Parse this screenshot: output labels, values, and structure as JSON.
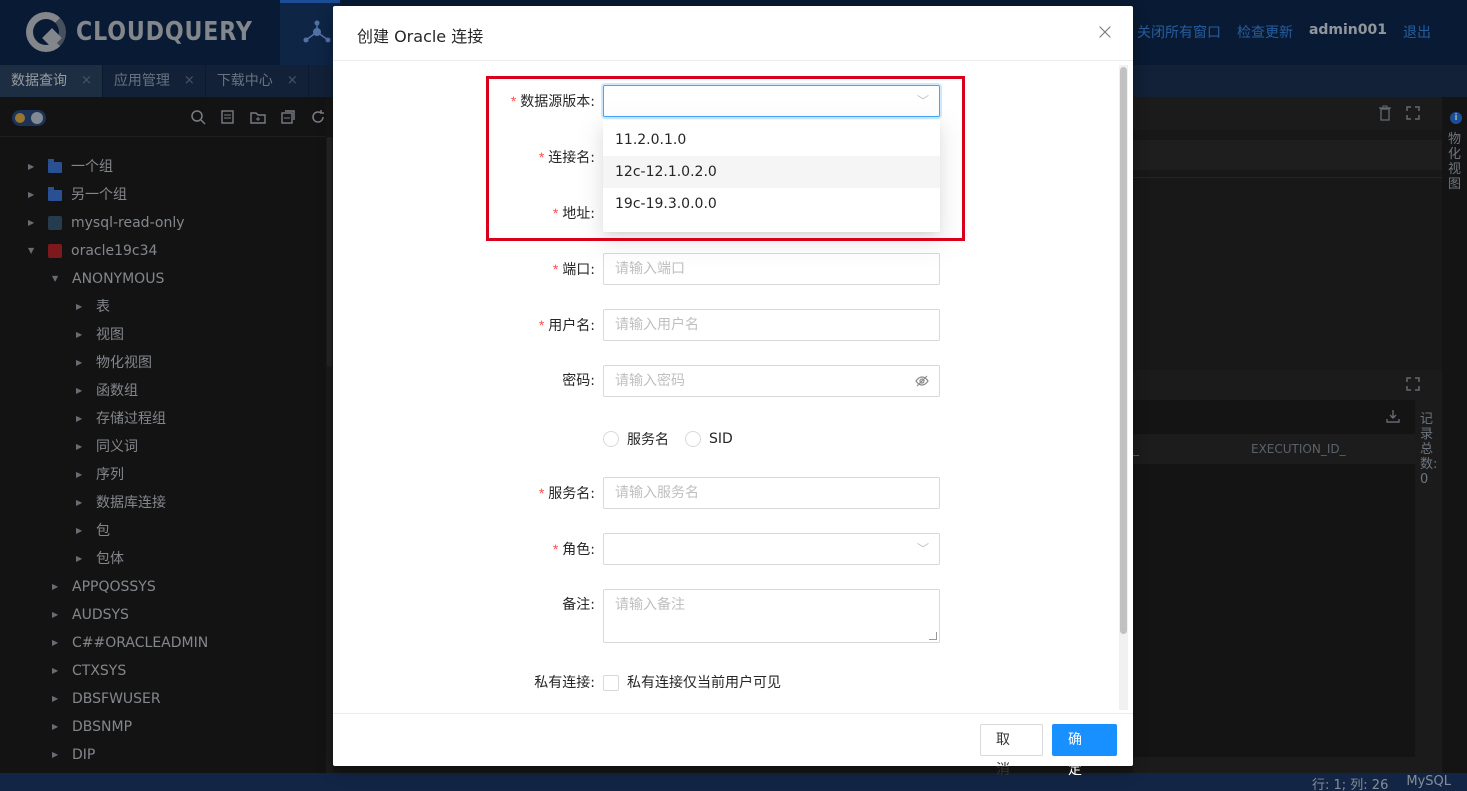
{
  "app": {
    "logo_text": "CLOUDQUERY",
    "top_links": [
      "关闭所有窗口",
      "检查更新"
    ],
    "user": "admin001",
    "logout": "退出"
  },
  "tabs": [
    {
      "label": "数据查询",
      "close": "×"
    },
    {
      "label": "应用管理",
      "close": "×"
    },
    {
      "label": "下载中心",
      "close": "×"
    }
  ],
  "tree": [
    {
      "label": "一个组",
      "level": 0,
      "icon": "folder-icon"
    },
    {
      "label": "另一个组",
      "level": 0,
      "icon": "folder-icon"
    },
    {
      "label": "mysql-read-only",
      "level": 0,
      "icon": "mysql-icon"
    },
    {
      "label": "oracle19c34",
      "level": 0,
      "icon": "oracle-icon",
      "expanded": true
    },
    {
      "label": "ANONYMOUS",
      "level": 1,
      "expanded": true
    },
    {
      "label": "表",
      "level": 2
    },
    {
      "label": "视图",
      "level": 2
    },
    {
      "label": "物化视图",
      "level": 2
    },
    {
      "label": "函数组",
      "level": 2
    },
    {
      "label": "存储过程组",
      "level": 2
    },
    {
      "label": "同义词",
      "level": 2
    },
    {
      "label": "序列",
      "level": 2
    },
    {
      "label": "数据库连接",
      "level": 2
    },
    {
      "label": "包",
      "level": 2
    },
    {
      "label": "包体",
      "level": 2
    },
    {
      "label": "APPQOSSYS",
      "level": 1
    },
    {
      "label": "AUDSYS",
      "level": 1
    },
    {
      "label": "C##ORACLEADMIN",
      "level": 1
    },
    {
      "label": "CTXSYS",
      "level": 1
    },
    {
      "label": "DBSFWUSER",
      "level": 1
    },
    {
      "label": "DBSNMP",
      "level": 1
    },
    {
      "label": "DIP",
      "level": 1
    }
  ],
  "right_panel": {
    "vertical_label_1": "物化视图",
    "vertical_label_2": "记录总数: 0",
    "col_partial": "_",
    "col_exec": "EXECUTION_ID_"
  },
  "status": {
    "position": "行: 1; 列: 26",
    "dialect": "MySQL"
  },
  "modal": {
    "title": "创建 Oracle 连接",
    "close": "×",
    "fields": {
      "version_label": "数据源版本:",
      "conn_name_label": "连接名:",
      "address_label": "地址:",
      "port_label": "端口:",
      "port_placeholder": "请输入端口",
      "user_label": "用户名:",
      "user_placeholder": "请输入用户名",
      "password_label": "密码:",
      "password_placeholder": "请输入密码",
      "radio_service": "服务名",
      "radio_sid": "SID",
      "service_label": "服务名:",
      "service_placeholder": "请输入服务名",
      "role_label": "角色:",
      "remark_label": "备注:",
      "remark_placeholder": "请输入备注",
      "private_label": "私有连接:",
      "private_text": "私有连接仅当前用户可见"
    },
    "required_mark": "*",
    "version_options": [
      "11.2.0.1.0",
      "12c-12.1.0.2.0",
      "19c-19.3.0.0.0"
    ],
    "hovered_option": "12c-12.1.0.2.0",
    "cancel": "取 消",
    "ok": "确 定"
  },
  "colors": {
    "primary": "#1890ff",
    "required": "#ff4d4f",
    "highlight": "#d9001b",
    "topbar": "#0e2850"
  }
}
